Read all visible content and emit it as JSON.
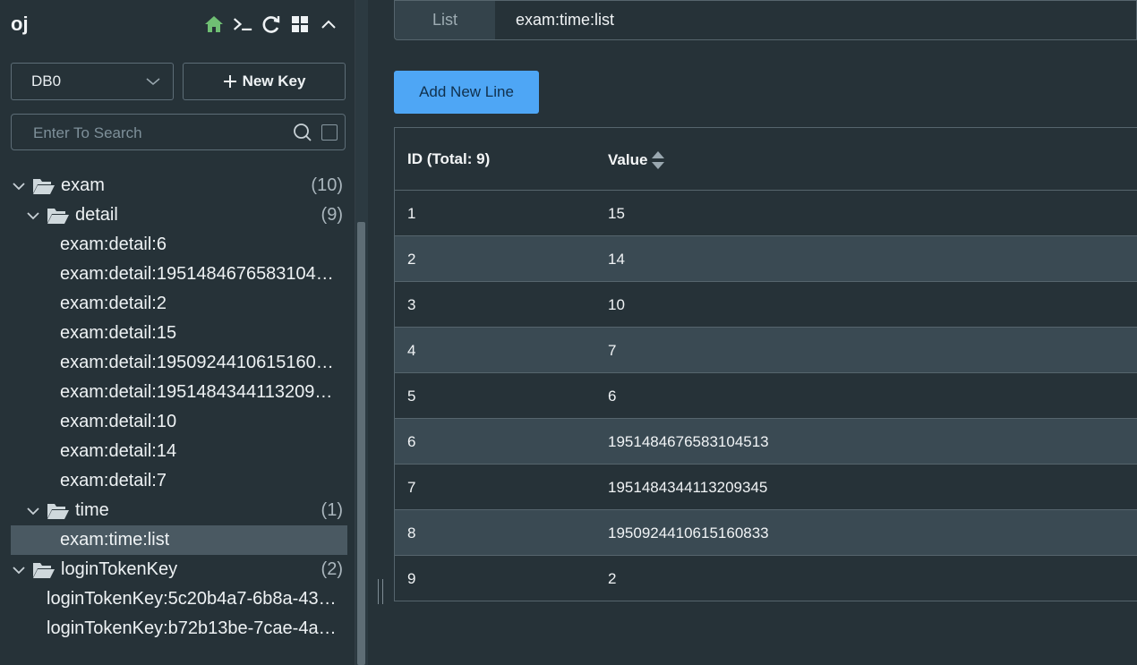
{
  "connection": {
    "name": "oj"
  },
  "toolbar": {
    "icons": [
      "home-icon",
      "terminal-icon",
      "refresh-icon",
      "grid-icon",
      "chevron-up-icon"
    ],
    "home_color": "#6fbf73"
  },
  "db_select": {
    "value": "DB0"
  },
  "new_key": {
    "label": "New Key"
  },
  "search": {
    "placeholder": "Enter To Search",
    "value": ""
  },
  "tree": [
    {
      "type": "folder",
      "label": "exam",
      "count": "(10)",
      "level": 0,
      "expanded": true
    },
    {
      "type": "folder",
      "label": "detail",
      "count": "(9)",
      "level": 1,
      "expanded": true
    },
    {
      "type": "key",
      "label": "exam:detail:6",
      "level": 2
    },
    {
      "type": "key",
      "label": "exam:detail:1951484676583104…",
      "level": 2
    },
    {
      "type": "key",
      "label": "exam:detail:2",
      "level": 2
    },
    {
      "type": "key",
      "label": "exam:detail:15",
      "level": 2
    },
    {
      "type": "key",
      "label": "exam:detail:1950924410615160…",
      "level": 2
    },
    {
      "type": "key",
      "label": "exam:detail:1951484344113209…",
      "level": 2
    },
    {
      "type": "key",
      "label": "exam:detail:10",
      "level": 2
    },
    {
      "type": "key",
      "label": "exam:detail:14",
      "level": 2
    },
    {
      "type": "key",
      "label": "exam:detail:7",
      "level": 2
    },
    {
      "type": "folder",
      "label": "time",
      "count": "(1)",
      "level": 1,
      "expanded": true
    },
    {
      "type": "key",
      "label": "exam:time:list",
      "level": 2,
      "selected": true
    },
    {
      "type": "folder",
      "label": "loginTokenKey",
      "count": "(2)",
      "level": 0,
      "expanded": true
    },
    {
      "type": "key",
      "label": "loginTokenKey:5c20b4a7-6b8a-43…",
      "level": 1
    },
    {
      "type": "key",
      "label": "loginTokenKey:b72b13be-7cae-4a…",
      "level": 1
    }
  ],
  "key_view": {
    "type_label": "List",
    "key_name": "exam:time:list",
    "add_line_label": "Add New Line",
    "header_id": "ID (Total: 9)",
    "header_value": "Value",
    "rows": [
      {
        "id": "1",
        "value": "15"
      },
      {
        "id": "2",
        "value": "14"
      },
      {
        "id": "3",
        "value": "10"
      },
      {
        "id": "4",
        "value": "7"
      },
      {
        "id": "5",
        "value": "6"
      },
      {
        "id": "6",
        "value": "1951484676583104513"
      },
      {
        "id": "7",
        "value": "1951484344113209345"
      },
      {
        "id": "8",
        "value": "1950924410615160833"
      },
      {
        "id": "9",
        "value": "2"
      }
    ]
  },
  "colors": {
    "background": "#263238",
    "accent": "#4ea6f5",
    "selected_row": "#4a5962",
    "alt_row": "#3a4a53"
  }
}
